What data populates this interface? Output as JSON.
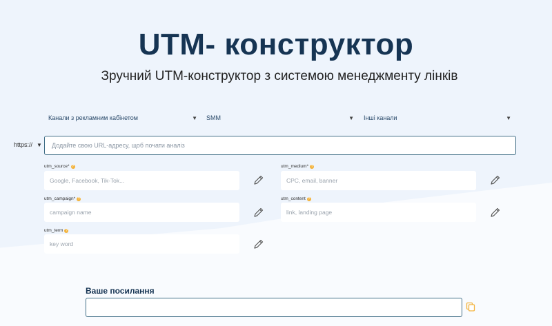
{
  "header": {
    "title": "UTM- конструктор",
    "subtitle": "Зручний UTM-конструктор з системою менеджменту лінків"
  },
  "channels": [
    {
      "label": "Канали з рекламним кабінетом"
    },
    {
      "label": "SMM"
    },
    {
      "label": "Інші канали"
    }
  ],
  "url": {
    "protocol": "https://",
    "placeholder": "Додайте свою URL-адресу, щоб почати аналіз",
    "value": ""
  },
  "fields": {
    "utm_source": {
      "label": "utm_source*",
      "placeholder": "Google, Facebook, Tik-Tok..."
    },
    "utm_medium": {
      "label": "utm_medium*",
      "placeholder": "CPC, email, banner"
    },
    "utm_campaign": {
      "label": "utm_campaign*",
      "placeholder": "campaign name"
    },
    "utm_content": {
      "label": "utm_content",
      "placeholder": "link, landing page"
    },
    "utm_term": {
      "label": "utm_term",
      "placeholder": "key word"
    }
  },
  "help_icon_glyph": "?",
  "result": {
    "label": "Ваше посилання",
    "value": ""
  },
  "colors": {
    "title": "#163453",
    "accent_border": "#3f6d86",
    "help_icon": "#f3b33d",
    "copy_icon": "#f3b33d"
  },
  "icons": {
    "dropdown": "caret-down-icon",
    "edit": "pencil-icon",
    "copy": "copy-icon",
    "help": "help-icon"
  }
}
